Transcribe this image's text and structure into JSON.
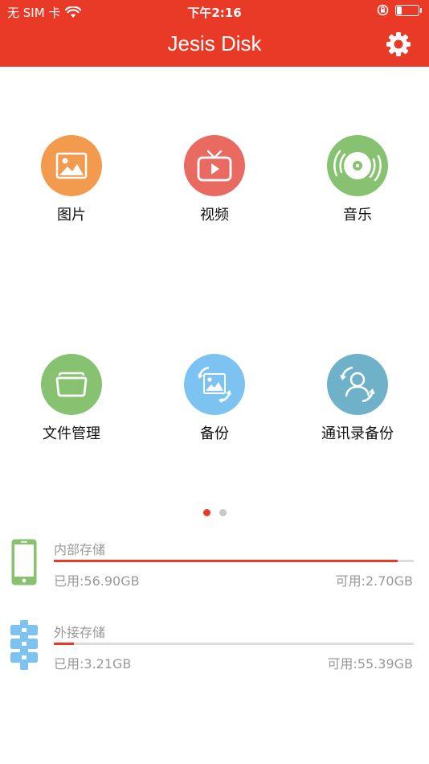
{
  "status_bar": {
    "carrier": "无 SIM 卡",
    "time": "下午2:16",
    "battery_level": 0.2
  },
  "header": {
    "title": "Jesis Disk",
    "settings_icon": "gear-icon",
    "background": "#e93a28"
  },
  "features": [
    {
      "label": "图片",
      "icon": "image-icon",
      "color": "#f29a4d"
    },
    {
      "label": "视频",
      "icon": "tv-play-icon",
      "color": "#e86a60"
    },
    {
      "label": "音乐",
      "icon": "disc-icon",
      "color": "#86c26f"
    },
    {
      "label": "文件管理",
      "icon": "folder-icon",
      "color": "#86c26f"
    },
    {
      "label": "备份",
      "icon": "photo-backup-icon",
      "color": "#7cc3f2"
    },
    {
      "label": "通讯录备份",
      "icon": "contacts-backup-icon",
      "color": "#6fb1c8"
    }
  ],
  "pager": {
    "pages": 2,
    "current": 1
  },
  "storage": {
    "internal": {
      "title": "内部存储",
      "used_label": "已用:56.90GB",
      "free_label": "可用:2.70GB",
      "used_fraction": 0.955,
      "icon": "phone-icon"
    },
    "external": {
      "title": "外接存储",
      "used_label": "已用:3.21GB",
      "free_label": "可用:55.39GB",
      "used_fraction": 0.055,
      "icon": "external-drive-icon"
    }
  }
}
